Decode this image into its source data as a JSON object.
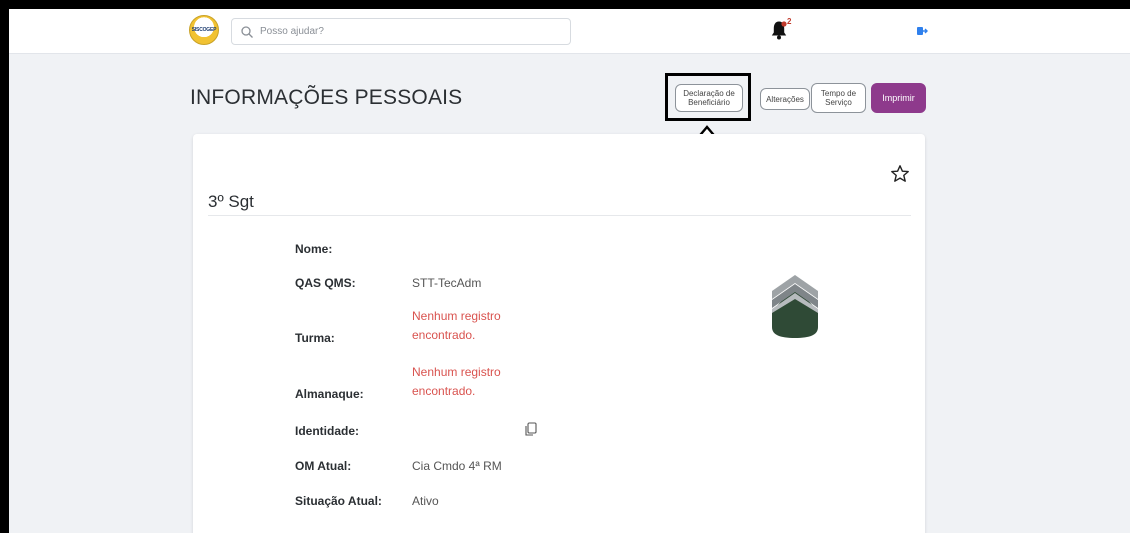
{
  "topbar": {
    "logo_text": "SISCOGEP",
    "search_placeholder": "Posso ajudar?",
    "notification_count": "2"
  },
  "header": {
    "title": "INFORMAÇÕES PESSOAIS",
    "buttons": {
      "declaracao_line1": "Declaração de",
      "declaracao_line2": "Beneficiário",
      "alteracoes": "Alterações",
      "tempo_line1": "Tempo de",
      "tempo_line2": "Serviço",
      "imprimir": "Imprimir"
    }
  },
  "card": {
    "rank": "3º Sgt",
    "fields": {
      "nome_label": "Nome:",
      "nome_value": "",
      "qas_label": "QAS QMS:",
      "qas_value": "STT-TecAdm",
      "turma_label": "Turma:",
      "turma_value_line1": "Nenhum registro",
      "turma_value_line2": "encontrado.",
      "almanaque_label": "Almanaque:",
      "almanaque_value_line1": "Nenhum registro",
      "almanaque_value_line2": "encontrado.",
      "identidade_label": "Identidade:",
      "identidade_value": "",
      "om_label": "OM Atual:",
      "om_value": "Cia Cmdo 4ª RM",
      "situacao_label": "Situação Atual:",
      "situacao_value": "Ativo"
    }
  },
  "icons": {
    "search": "search-icon",
    "bell": "bell-icon",
    "logout": "logout-icon",
    "star": "star-outline-icon",
    "copy": "copy-icon",
    "insignia": "rank-insignia-icon",
    "arrow": "up-arrow-annotation"
  },
  "colors": {
    "accent_purple": "#8e3a8c",
    "error_red": "#d9534f",
    "badge_red": "#c0392b",
    "insignia_green": "#2f4a36"
  }
}
